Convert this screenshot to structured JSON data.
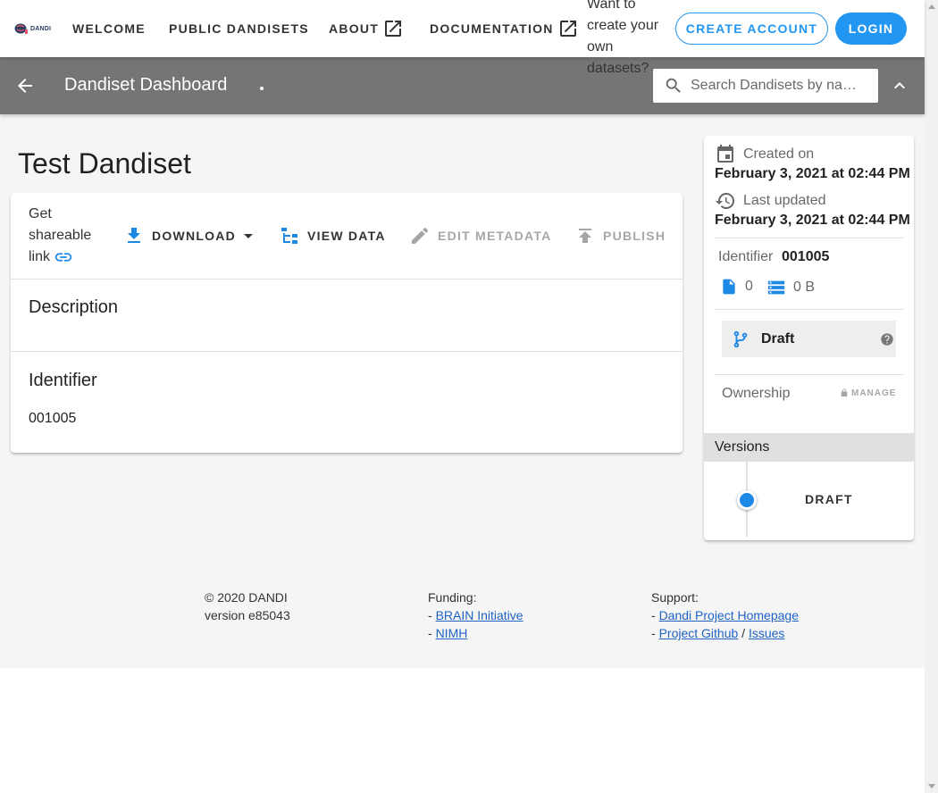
{
  "nav": {
    "logo_text": "DANDI",
    "links": [
      {
        "label": "Welcome"
      },
      {
        "label": "Public Dandisets"
      },
      {
        "label": "About"
      },
      {
        "label": "Documentation"
      }
    ],
    "signup_tip": "Want to create your own datasets?",
    "create_account_label": "Create Account",
    "login_label": "Login"
  },
  "toolbar": {
    "title": "Dandiset Dashboard",
    "search_placeholder": "Search Dandisets by na…"
  },
  "dandiset": {
    "title": "Test Dandiset",
    "share_label": "Get shareable link",
    "actions": {
      "download": "Download",
      "view_data": "View Data",
      "edit_metadata": "Edit Metadata",
      "publish": "Publish"
    },
    "description_heading": "Description",
    "identifier_heading": "Identifier",
    "identifier_value": "001005"
  },
  "meta": {
    "created_label": "Created on",
    "created_date": "February 3, 2021 at 02:44 PM",
    "updated_label": "Last updated",
    "updated_date": "February 3, 2021 at 02:44 PM",
    "identifier_label": "Identifier",
    "identifier_value": "001005",
    "file_count": "0",
    "size": "0 B",
    "status": "Draft",
    "ownership_label": "Ownership",
    "manage_label": "MANAGE",
    "versions_heading": "Versions",
    "versions": [
      "DRAFT"
    ]
  },
  "footer": {
    "copyright": "© 2020 DANDI",
    "version": "version e85043",
    "funding_label": "Funding:",
    "funding_links": [
      "BRAIN Initiative",
      "NIMH"
    ],
    "support_label": "Support:",
    "support_home": "Dandi Project Homepage",
    "support_github": "Project Github",
    "support_sep": "/",
    "support_issues": "Issues",
    "dash": "-"
  },
  "colors": {
    "accent": "#2196f3",
    "icon_blue": "#1e88e5",
    "toolbar": "#757575"
  }
}
